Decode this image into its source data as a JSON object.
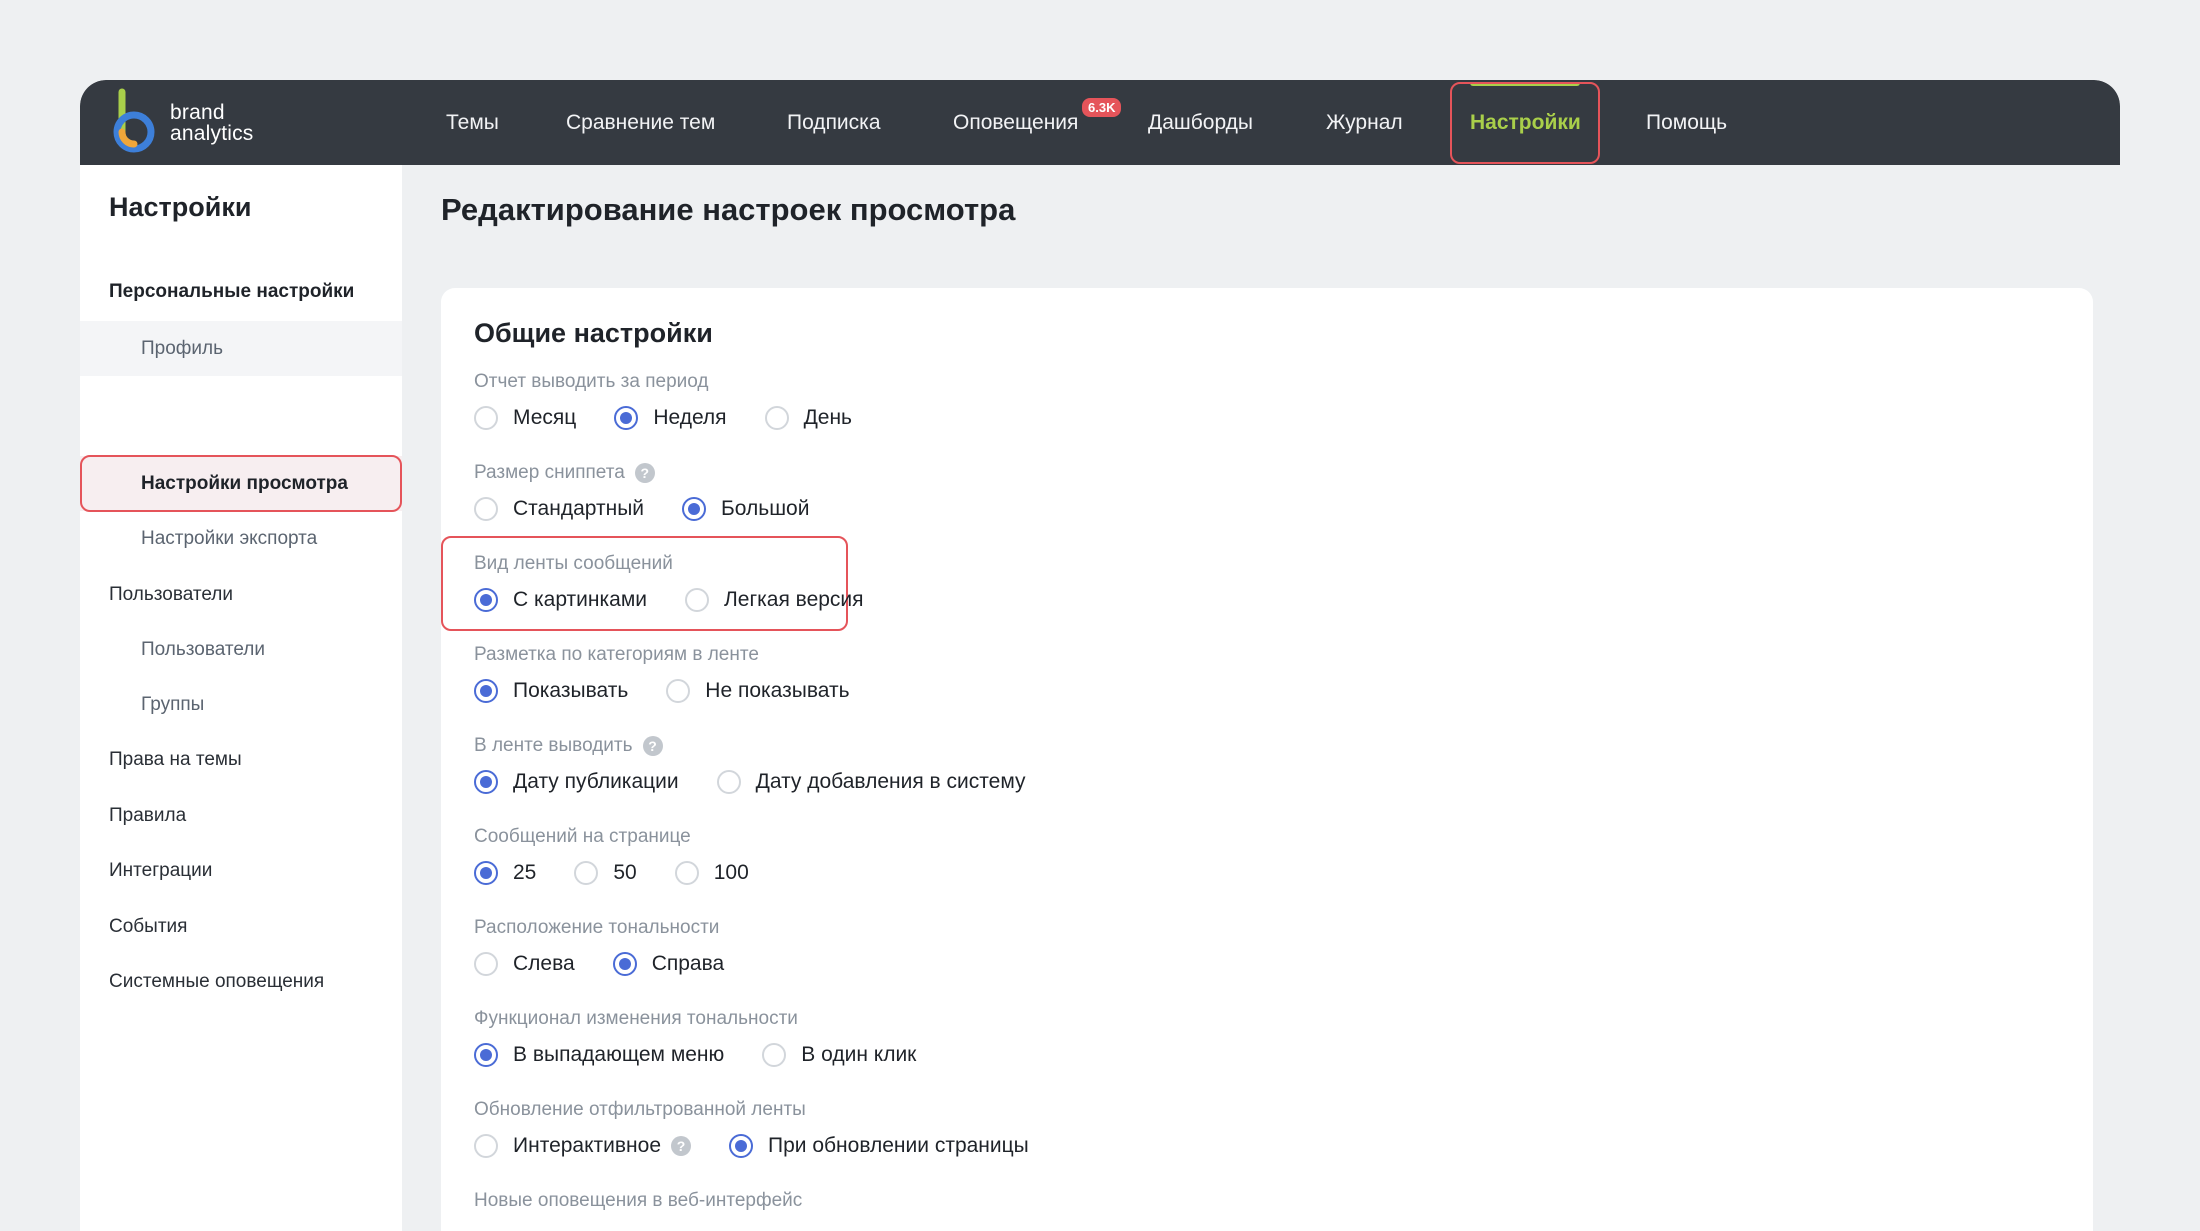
{
  "brand": {
    "line1": "brand",
    "line2": "analytics"
  },
  "nav": {
    "items": [
      {
        "label": "Темы"
      },
      {
        "label": "Сравнение тем"
      },
      {
        "label": "Подписка"
      },
      {
        "label": "Оповещения"
      },
      {
        "label": "Дашборды"
      },
      {
        "label": "Журнал"
      },
      {
        "label": "Настройки"
      },
      {
        "label": "Помощь"
      }
    ],
    "notifications_badge": "6.3K",
    "active": "Настройки"
  },
  "sidebar": {
    "title": "Настройки",
    "items": [
      {
        "label": "Персональные настройки"
      },
      {
        "label": "Профиль"
      },
      {
        "label": "Настройки просмотра"
      },
      {
        "label": "Настройки экспорта"
      },
      {
        "label": "Пользователи"
      },
      {
        "label": "Пользователи"
      },
      {
        "label": "Группы"
      },
      {
        "label": "Права на темы"
      },
      {
        "label": "Правила"
      },
      {
        "label": "Интеграции"
      },
      {
        "label": "События"
      },
      {
        "label": "Системные оповещения"
      }
    ],
    "selected": "Настройки просмотра"
  },
  "page": {
    "title": "Редактирование настроек просмотра"
  },
  "card": {
    "title": "Общие настройки",
    "groups": [
      {
        "label": "Отчет выводить за период",
        "options": [
          "Месяц",
          "Неделя",
          "День"
        ],
        "selected": "Неделя"
      },
      {
        "label": "Размер сниппета",
        "help": "?",
        "options": [
          "Стандартный",
          "Большой"
        ],
        "selected": "Большой"
      },
      {
        "label": "Вид ленты сообщений",
        "options": [
          "С картинками",
          "Легкая версия"
        ],
        "selected": "С картинками"
      },
      {
        "label": "Разметка по категориям в ленте",
        "options": [
          "Показывать",
          "Не показывать"
        ],
        "selected": "Показывать"
      },
      {
        "label": "В ленте выводить",
        "help": "?",
        "options": [
          "Дату публикации",
          "Дату добавления в систему"
        ],
        "selected": "Дату публикации"
      },
      {
        "label": "Сообщений на странице",
        "options": [
          "25",
          "50",
          "100"
        ],
        "selected": "25"
      },
      {
        "label": "Расположение тональности",
        "options": [
          "Слева",
          "Справа"
        ],
        "selected": "Справа"
      },
      {
        "label": "Функционал изменения тональности",
        "options": [
          "В выпадающем меню",
          "В один клик"
        ],
        "selected": "В выпадающем меню"
      },
      {
        "label": "Обновление отфильтрованной ленты",
        "options": [
          "Интерактивное",
          "При обновлении страницы"
        ],
        "selected": "При обновлении страницы",
        "option_help": "?"
      },
      {
        "label": "Новые оповещения в веб-интерфейс"
      }
    ]
  },
  "colors": {
    "topbar": "#353a41",
    "accent_green": "#a9cf4a",
    "radio_blue": "#4a6bd6",
    "highlight_red": "#e5545a"
  }
}
